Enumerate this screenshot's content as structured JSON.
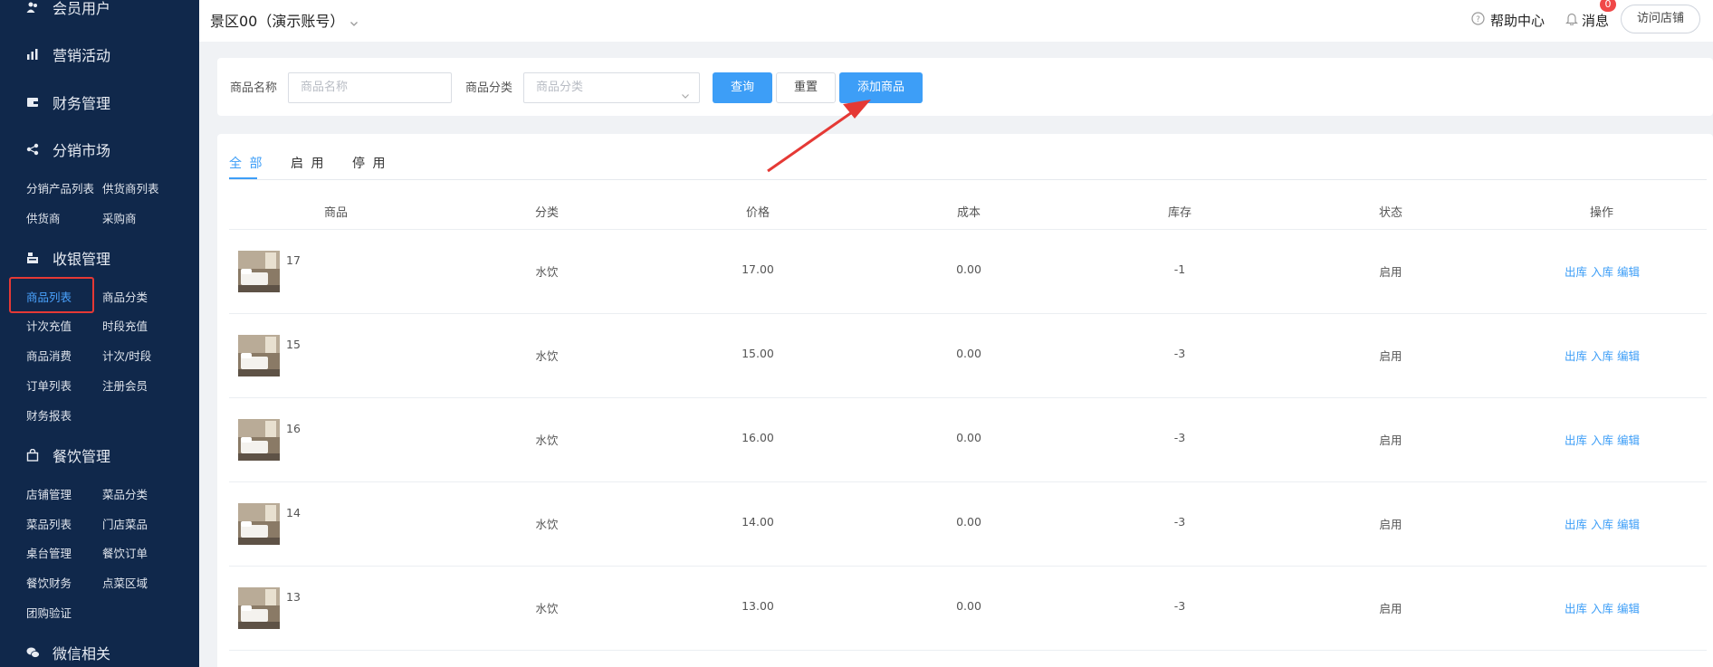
{
  "sidebar": {
    "groups": [
      {
        "label": "会员用户",
        "icon": "users-icon"
      },
      {
        "label": "营销活动",
        "icon": "chart-icon"
      },
      {
        "label": "财务管理",
        "icon": "wallet-icon"
      },
      {
        "label": "分销市场",
        "icon": "share-icon"
      },
      {
        "label": "收银管理",
        "icon": "cashier-icon"
      },
      {
        "label": "餐饮管理",
        "icon": "bag-icon"
      },
      {
        "label": "微信相关",
        "icon": "wechat-icon"
      }
    ],
    "distribution_items": [
      "分销产品列表",
      "供货商列表",
      "供货商",
      "采购商"
    ],
    "cashier_items": [
      "商品列表",
      "商品分类",
      "计次充值",
      "时段充值",
      "商品消费",
      "计次/时段",
      "订单列表",
      "注册会员",
      "财务报表"
    ],
    "catering_items": [
      "店铺管理",
      "菜品分类",
      "菜品列表",
      "门店菜品",
      "桌台管理",
      "餐饮订单",
      "餐饮财务",
      "点菜区域",
      "团购验证"
    ]
  },
  "header": {
    "title": "景区00（演示账号）",
    "help": "帮助中心",
    "messages": "消息",
    "badge": "0",
    "visit_shop": "访问店铺"
  },
  "search": {
    "name_label": "商品名称",
    "name_placeholder": "商品名称",
    "category_label": "商品分类",
    "category_placeholder": "商品分类",
    "query_button": "查询",
    "reset_button": "重置",
    "add_button": "添加商品"
  },
  "tabs": [
    "全 部",
    "启 用",
    "停 用"
  ],
  "table": {
    "headers": [
      "商品",
      "分类",
      "价格",
      "成本",
      "库存",
      "状态",
      "操作"
    ],
    "rows": [
      {
        "name": "17",
        "category": "水饮",
        "price": "17.00",
        "cost": "0.00",
        "stock": "-1",
        "status": "启用"
      },
      {
        "name": "15",
        "category": "水饮",
        "price": "15.00",
        "cost": "0.00",
        "stock": "-3",
        "status": "启用"
      },
      {
        "name": "16",
        "category": "水饮",
        "price": "16.00",
        "cost": "0.00",
        "stock": "-3",
        "status": "启用"
      },
      {
        "name": "14",
        "category": "水饮",
        "price": "14.00",
        "cost": "0.00",
        "stock": "-3",
        "status": "启用"
      },
      {
        "name": "13",
        "category": "水饮",
        "price": "13.00",
        "cost": "0.00",
        "stock": "-3",
        "status": "启用"
      }
    ],
    "actions": [
      "出库",
      "入库",
      "编辑"
    ]
  },
  "colors": {
    "sidebar_bg": "#10284b",
    "accent": "#3d9ef7",
    "annotation": "#e53935"
  }
}
